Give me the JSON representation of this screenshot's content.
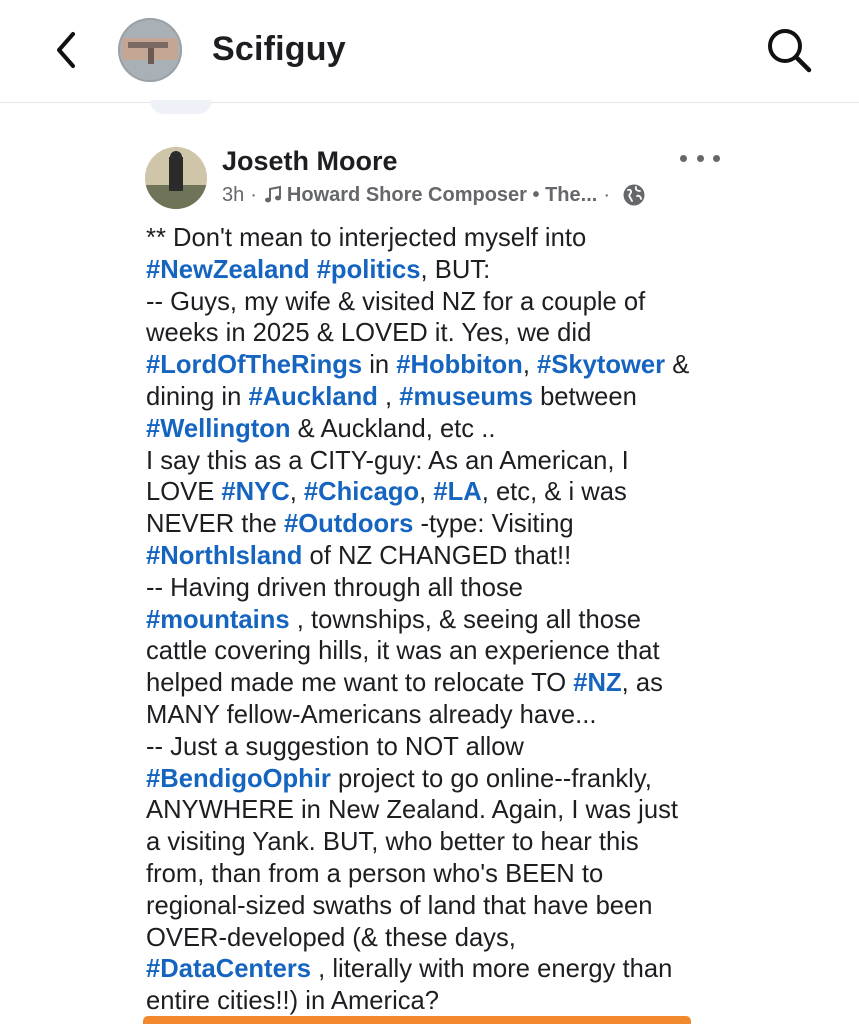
{
  "header": {
    "title": "Scifiguy",
    "back_icon": "chevron-left-icon",
    "search_icon": "search-icon"
  },
  "post": {
    "author": "Joseth Moore",
    "time": "3h",
    "separator": "·",
    "music": "Howard Shore Composer • The...",
    "audience_icon": "globe-icon",
    "body_lines": [
      [
        {
          "t": "** Don't mean to interjected myself into"
        }
      ],
      [
        {
          "t": "#NewZealand",
          "tag": true
        },
        {
          "t": " "
        },
        {
          "t": "#politics",
          "tag": true
        },
        {
          "t": ", BUT:"
        }
      ],
      [
        {
          "t": "-- Guys, my wife & visited NZ for a couple of"
        }
      ],
      [
        {
          "t": "weeks in 2025 & LOVED it.  Yes, we did"
        }
      ],
      [
        {
          "t": "#LordOfTheRings",
          "tag": true
        },
        {
          "t": " in "
        },
        {
          "t": "#Hobbiton",
          "tag": true
        },
        {
          "t": ", "
        },
        {
          "t": "#Skytower",
          "tag": true
        },
        {
          "t": " &"
        }
      ],
      [
        {
          "t": "dining in "
        },
        {
          "t": "#Auckland",
          "tag": true
        },
        {
          "t": " , "
        },
        {
          "t": "#museums",
          "tag": true
        },
        {
          "t": " between"
        }
      ],
      [
        {
          "t": "#Wellington",
          "tag": true
        },
        {
          "t": " & Auckland, etc .."
        }
      ],
      [
        {
          "t": "I say this as a CITY-guy:  As an American, I"
        }
      ],
      [
        {
          "t": "LOVE  "
        },
        {
          "t": "#NYC",
          "tag": true
        },
        {
          "t": ", "
        },
        {
          "t": "#Chicago",
          "tag": true
        },
        {
          "t": ", "
        },
        {
          "t": "#LA",
          "tag": true
        },
        {
          "t": ", etc, & i was"
        }
      ],
      [
        {
          "t": "NEVER the "
        },
        {
          "t": "#Outdoors",
          "tag": true
        },
        {
          "t": " -type:  Visiting"
        }
      ],
      [
        {
          "t": "#NorthIsland",
          "tag": true
        },
        {
          "t": " of NZ CHANGED that!!"
        }
      ],
      [
        {
          "t": "-- Having driven through all those"
        }
      ],
      [
        {
          "t": "#mountains",
          "tag": true
        },
        {
          "t": " , townships,  & seeing all those"
        }
      ],
      [
        {
          "t": "cattle covering hills, it was an experience that"
        }
      ],
      [
        {
          "t": "helped made me want to relocate TO "
        },
        {
          "t": "#NZ",
          "tag": true
        },
        {
          "t": ", as"
        }
      ],
      [
        {
          "t": "MANY fellow-Americans already have..."
        }
      ],
      [
        {
          "t": "-- Just a suggestion to NOT allow"
        }
      ],
      [
        {
          "t": "#BendigoOphir",
          "tag": true
        },
        {
          "t": " project to go online--frankly,"
        }
      ],
      [
        {
          "t": "ANYWHERE in New Zealand.  Again, I was just"
        }
      ],
      [
        {
          "t": "a visiting Yank. BUT, who better to hear this"
        }
      ],
      [
        {
          "t": "from, than from a person who's BEEN to"
        }
      ],
      [
        {
          "t": "regional-sized swaths of land that have been"
        }
      ],
      [
        {
          "t": "OVER-developed (& these days,"
        }
      ],
      [
        {
          "t": "#DataCenters",
          "tag": true
        },
        {
          "t": " , literally with more energy than"
        }
      ],
      [
        {
          "t": "entire cities!!) in America?"
        }
      ]
    ]
  },
  "colors": {
    "hashtag": "#1565c0",
    "text": "#1c1e21",
    "meta": "#65676b",
    "accent_bar": "#f2892e"
  }
}
